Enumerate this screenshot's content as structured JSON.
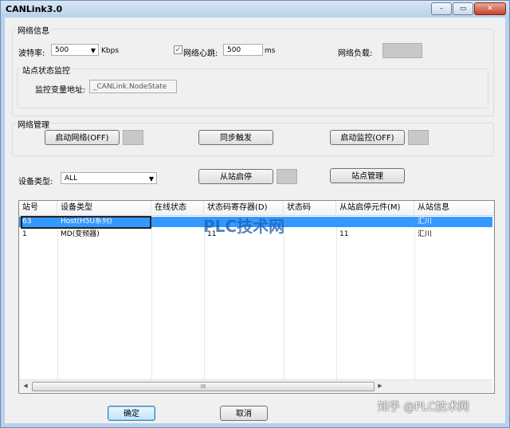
{
  "window": {
    "title": "CANLink3.0",
    "controls": [
      "–",
      "▭",
      "✕"
    ]
  },
  "net_info": {
    "group_label": "网络信息",
    "baud_label": "波特率:",
    "baud_value": "500",
    "baud_unit": "Kbps",
    "heartbeat_checked": true,
    "heartbeat_label": "网络心跳:",
    "heartbeat_value": "500",
    "heartbeat_unit": "ms",
    "load_label": "网络负载:",
    "monitor_group_label": "站点状态监控",
    "monitor_addr_label": "监控变量地址:",
    "monitor_addr_value": "_CANLink.NodeState"
  },
  "net_mgmt": {
    "group_label": "网络管理",
    "start_net_btn": "启动网络(OFF)",
    "sync_trigger_btn": "同步触发",
    "start_monitor_btn": "启动监控(OFF)"
  },
  "device_filter": {
    "label": "设备类型:",
    "value": "ALL",
    "slave_start_btn": "从站启停",
    "station_mgmt_btn": "站点管理"
  },
  "table": {
    "columns": [
      "站号",
      "设备类型",
      "在线状态",
      "状态码寄存器(D)",
      "状态码",
      "从站启停元件(M)",
      "从站信息"
    ],
    "rows": [
      [
        "63",
        "Host(H5U系列)",
        "",
        "",
        "",
        "",
        "汇川"
      ],
      [
        "1",
        "MD(变频器)",
        "",
        "11",
        "",
        "11",
        "汇川"
      ]
    ],
    "scroll_thumb": "III"
  },
  "footer": {
    "ok_btn": "确定",
    "cancel_btn": "取消"
  },
  "watermarks": {
    "center": "PLC技术网",
    "corner": "知乎 @PLC技术网"
  }
}
